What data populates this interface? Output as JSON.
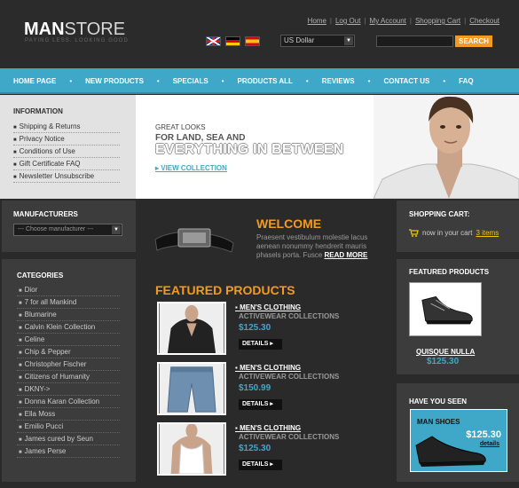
{
  "logo": {
    "brand_a": "MAN",
    "brand_b": "STORE",
    "tagline": "PAYING LESS. LOOKING GOOD"
  },
  "top_links": [
    "Home",
    "Log Out",
    "My Account",
    "Shopping Cart",
    "Checkout"
  ],
  "currency": {
    "value": "US Dollar"
  },
  "search": {
    "button": "SEARCH",
    "placeholder": ""
  },
  "nav": [
    "HOME PAGE",
    "NEW PRODUCTS",
    "SPECIALS",
    "PRODUCTS ALL",
    "REVIEWS",
    "CONTACT US",
    "FAQ"
  ],
  "information": {
    "title": "INFORMATION",
    "items": [
      "Shipping & Returns",
      "Privacy Notice",
      "Conditions of Use",
      "Gift Certificate FAQ",
      "Newsletter Unsubscribe"
    ]
  },
  "banner": {
    "line1": "GREAT LOOKS",
    "line2": "FOR LAND, SEA AND",
    "line3": "EVERYTHING IN BETWEEN",
    "link": "VIEW COLLECTION"
  },
  "manufacturers": {
    "title": "MANUFACTURERS",
    "select": "--- Choose manufacturer ---"
  },
  "categories": {
    "title": "CATEGORIES",
    "items": [
      "Dior",
      "7 for all Mankind",
      "Blumarine",
      "Calvin Klein Collection",
      "Celine",
      "Chip & Pepper",
      "Christopher Fischer",
      "Citizens of Humanity",
      "DKNY->",
      "Donna Karan Collection",
      "Ella Moss",
      "Emilio Pucci",
      "James cured by Seun",
      "James Perse"
    ]
  },
  "welcome": {
    "title": "WELCOME",
    "text": "Praesent vestibulum molestie lacus aenean nonummy hendrerit mauris phasels porta. Fusce",
    "read_more": "READ MORE"
  },
  "featured": {
    "title": "FEATURED PRODUCTS",
    "products": [
      {
        "name": "MEN'S CLOTHING",
        "sub": "ACTIVEWEAR COLLECTIONS",
        "price": "$125.30",
        "details": "DETAILS"
      },
      {
        "name": "MEN'S CLOTHING",
        "sub": "ACTIVEWEAR COLLECTIONS",
        "price": "$150.99",
        "details": "DETAILS"
      },
      {
        "name": "MEN'S CLOTHING",
        "sub": "ACTIVEWEAR COLLECTIONS",
        "price": "$125.30",
        "details": "DETAILS"
      }
    ]
  },
  "cart": {
    "title": "SHOPPING CART:",
    "text": "now in your cart",
    "items": "3 items"
  },
  "featured_side": {
    "title": "FEATURED PRODUCTS",
    "name": "QUISQUE NULLA",
    "price": "$125.30"
  },
  "seen": {
    "title": "HAVE YOU SEEN",
    "label": "MAN SHOES",
    "price": "$125.30",
    "details": "details"
  },
  "colors": {
    "accent": "#f39a20",
    "nav": "#3fa8c8",
    "bg": "#2a2a2a"
  }
}
